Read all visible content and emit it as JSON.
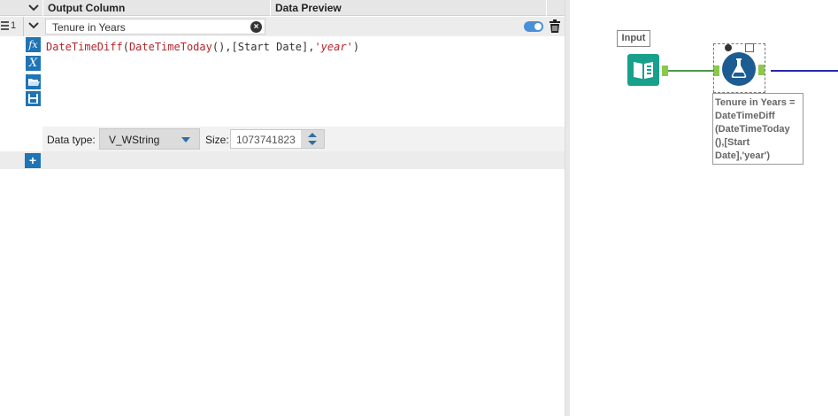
{
  "header": {
    "output_column": "Output Column",
    "data_preview": "Data Preview"
  },
  "row": {
    "number": "1",
    "name": "Tenure in Years",
    "enabled": true
  },
  "expression": {
    "func1": "DateTimeDiff",
    "func2": "DateTimeToday",
    "middle": "(),[Start Date],",
    "string": "'year'",
    "close": ")"
  },
  "side_icons": {
    "fx": "fx",
    "x": "X"
  },
  "typebar": {
    "data_type_label": "Data type:",
    "data_type_value": "V_WString",
    "size_label": "Size:",
    "size_value": "1073741823"
  },
  "canvas": {
    "input_label": "Input",
    "annotation": "Tenure in Years = DateTimeDiff (DateTimeToday (),[Start Date],'year')"
  },
  "colors": {
    "accent": "#1f74b5",
    "input_tool": "#17a08c",
    "formula_tool": "#1d5c92",
    "function_text": "#b3262b"
  },
  "icons": [
    "menu-handle-icon",
    "chevron-down-icon",
    "clear-icon",
    "toggle-switch",
    "trash-icon",
    "fx-icon",
    "variable-icon",
    "open-folder-icon",
    "save-icon",
    "plus-icon",
    "book-icon",
    "flask-icon"
  ]
}
